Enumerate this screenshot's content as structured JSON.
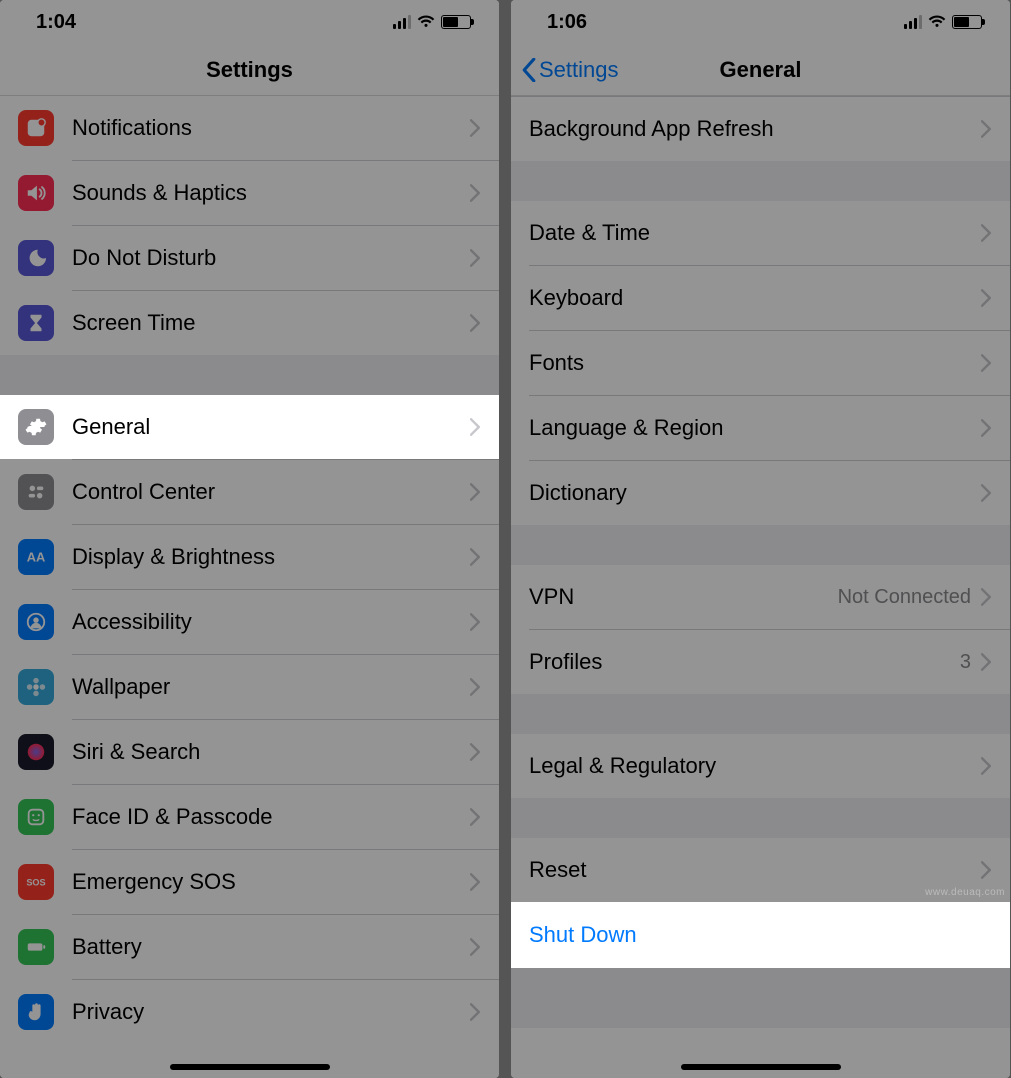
{
  "watermark": "www.deuaq.com",
  "left": {
    "status_time": "1:04",
    "nav_title": "Settings",
    "rows_top": [
      {
        "key": "notifications",
        "label": "Notifications",
        "icon": "square-badge",
        "color": "#ff3b30"
      },
      {
        "key": "sounds",
        "label": "Sounds & Haptics",
        "icon": "speaker",
        "color": "#ff2d55"
      },
      {
        "key": "dnd",
        "label": "Do Not Disturb",
        "icon": "moon",
        "color": "#5856d6"
      },
      {
        "key": "screentime",
        "label": "Screen Time",
        "icon": "hourglass",
        "color": "#5856d6"
      }
    ],
    "rows_general": {
      "key": "general",
      "label": "General",
      "icon": "gear",
      "color": "#8e8e93"
    },
    "rows_bottom": [
      {
        "key": "controlcenter",
        "label": "Control Center",
        "icon": "toggles",
        "color": "#8e8e93"
      },
      {
        "key": "display",
        "label": "Display & Brightness",
        "icon": "aa",
        "color": "#007aff"
      },
      {
        "key": "accessibility",
        "label": "Accessibility",
        "icon": "person-circle",
        "color": "#007aff"
      },
      {
        "key": "wallpaper",
        "label": "Wallpaper",
        "icon": "flower",
        "color": "#34aadc"
      },
      {
        "key": "siri",
        "label": "Siri & Search",
        "icon": "siri",
        "color": "#1b1b2e"
      },
      {
        "key": "faceid",
        "label": "Face ID & Passcode",
        "icon": "face",
        "color": "#34c759"
      },
      {
        "key": "sos",
        "label": "Emergency SOS",
        "icon": "sos-text",
        "color": "#ff3b30"
      },
      {
        "key": "battery",
        "label": "Battery",
        "icon": "battery",
        "color": "#34c759"
      },
      {
        "key": "privacy",
        "label": "Privacy",
        "icon": "hand",
        "color": "#007aff"
      }
    ]
  },
  "right": {
    "status_time": "1:06",
    "nav_back": "Settings",
    "nav_title": "General",
    "group1": [
      {
        "key": "bgrefresh",
        "label": "Background App Refresh"
      }
    ],
    "group2": [
      {
        "key": "datetime",
        "label": "Date & Time"
      },
      {
        "key": "keyboard",
        "label": "Keyboard"
      },
      {
        "key": "fonts",
        "label": "Fonts"
      },
      {
        "key": "language",
        "label": "Language & Region"
      },
      {
        "key": "dictionary",
        "label": "Dictionary"
      }
    ],
    "group3": [
      {
        "key": "vpn",
        "label": "VPN",
        "detail": "Not Connected"
      },
      {
        "key": "profiles",
        "label": "Profiles",
        "detail": "3"
      }
    ],
    "group4": [
      {
        "key": "legal",
        "label": "Legal & Regulatory"
      }
    ],
    "group5": [
      {
        "key": "reset",
        "label": "Reset"
      }
    ],
    "shutdown": {
      "key": "shutdown",
      "label": "Shut Down"
    }
  }
}
